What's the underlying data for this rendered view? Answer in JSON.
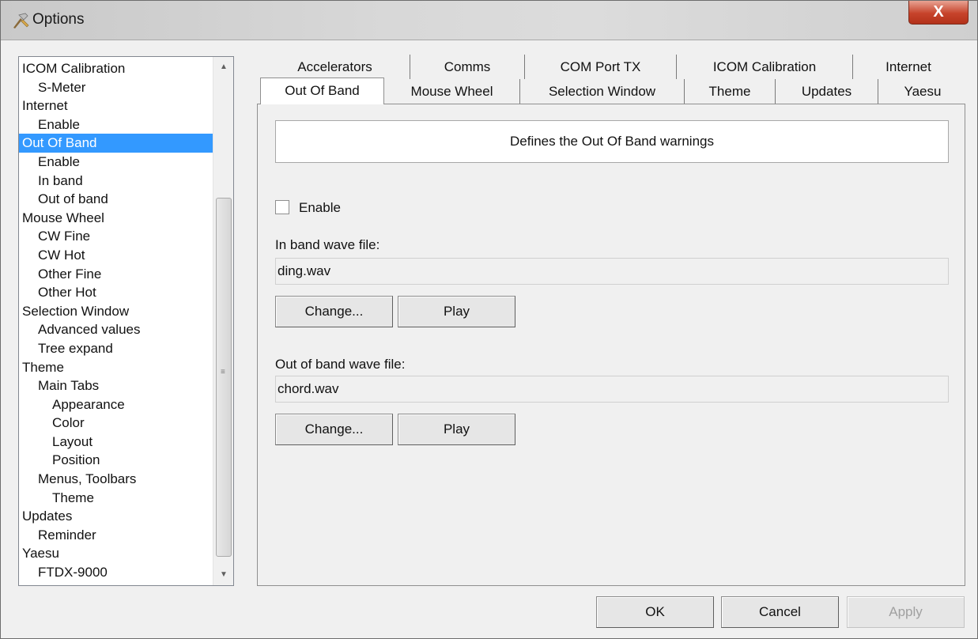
{
  "window": {
    "title": "Options",
    "icon": "options-app-icon",
    "close_glyph": "X"
  },
  "tree": {
    "items": [
      {
        "label": "ICOM Calibration",
        "level": 0
      },
      {
        "label": "S-Meter",
        "level": 1
      },
      {
        "label": "Internet",
        "level": 0
      },
      {
        "label": "Enable",
        "level": 1
      },
      {
        "label": "Out Of Band",
        "level": 0,
        "selected": true
      },
      {
        "label": "Enable",
        "level": 1
      },
      {
        "label": "In band",
        "level": 1
      },
      {
        "label": "Out of band",
        "level": 1
      },
      {
        "label": "Mouse Wheel",
        "level": 0
      },
      {
        "label": "CW Fine",
        "level": 1
      },
      {
        "label": "CW Hot",
        "level": 1
      },
      {
        "label": "Other Fine",
        "level": 1
      },
      {
        "label": "Other Hot",
        "level": 1
      },
      {
        "label": "Selection Window",
        "level": 0
      },
      {
        "label": "Advanced values",
        "level": 1
      },
      {
        "label": "Tree expand",
        "level": 1
      },
      {
        "label": "Theme",
        "level": 0
      },
      {
        "label": "Main Tabs",
        "level": 1
      },
      {
        "label": "Appearance",
        "level": 2
      },
      {
        "label": "Color",
        "level": 2
      },
      {
        "label": "Layout",
        "level": 2
      },
      {
        "label": "Position",
        "level": 2
      },
      {
        "label": "Menus, Toolbars",
        "level": 1
      },
      {
        "label": "Theme",
        "level": 2
      },
      {
        "label": "Updates",
        "level": 0
      },
      {
        "label": "Reminder",
        "level": 1
      },
      {
        "label": "Yaesu",
        "level": 0
      },
      {
        "label": "FTDX-9000",
        "level": 1
      }
    ]
  },
  "tabs": {
    "back_row": [
      "Accelerators",
      "Comms",
      "COM Port TX",
      "ICOM Calibration",
      "Internet"
    ],
    "front_row": [
      "Out Of Band",
      "Mouse Wheel",
      "Selection Window",
      "Theme",
      "Updates",
      "Yaesu"
    ],
    "selected": "Out Of Band"
  },
  "page": {
    "description": "Defines the Out Of Band warnings",
    "enable_label": "Enable",
    "enable_checked": false,
    "in_band_label": "In band wave file:",
    "in_band_value": "ding.wav",
    "out_band_label": "Out of band wave file:",
    "out_band_value": "chord.wav",
    "change_label": "Change...",
    "play_label": "Play"
  },
  "footer": {
    "ok_label": "OK",
    "cancel_label": "Cancel",
    "apply_label": "Apply"
  }
}
